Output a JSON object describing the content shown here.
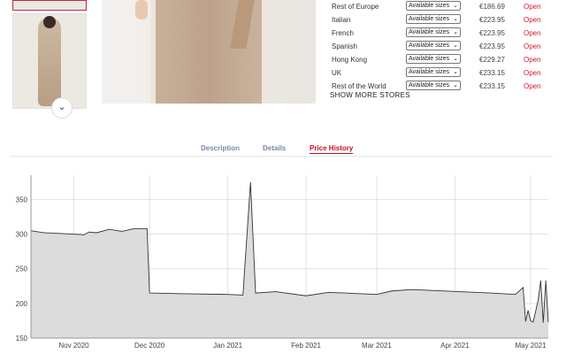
{
  "stores": [
    {
      "name": "Rest of Europe",
      "select": "Available sizes",
      "price": "€186.69",
      "status": "Open"
    },
    {
      "name": "Italian",
      "select": "Available sizes",
      "price": "€223.95",
      "status": "Open"
    },
    {
      "name": "French",
      "select": "Available sizes",
      "price": "€223.95",
      "status": "Open"
    },
    {
      "name": "Spanish",
      "select": "Available sizes",
      "price": "€223.95",
      "status": "Open"
    },
    {
      "name": "Hong Kong",
      "select": "Available sizes",
      "price": "€229.27",
      "status": "Open"
    },
    {
      "name": "UK",
      "select": "Available sizes",
      "price": "€233.15",
      "status": "Open"
    },
    {
      "name": "Rest of the World",
      "select": "Available sizes",
      "price": "€233.15",
      "status": "Open"
    }
  ],
  "show_more": "SHOW MORE STORES",
  "tabs": [
    "Description",
    "Details",
    "Price History"
  ],
  "active_tab": "Price History",
  "chart_data": {
    "type": "area",
    "yticks": [
      150,
      200,
      250,
      300,
      350
    ],
    "ylim": [
      150,
      385
    ],
    "xticks": [
      "Nov 2020",
      "Dec 2020",
      "Jan 2021",
      "Feb 2021",
      "Mar 2021",
      "Apr 2021",
      "May 2021"
    ],
    "color": "#dcdcdc",
    "line_color": "#333333",
    "points": [
      [
        "2020-10-15",
        305
      ],
      [
        "2020-10-20",
        302
      ],
      [
        "2020-11-01",
        300
      ],
      [
        "2020-11-05",
        299
      ],
      [
        "2020-11-07",
        303
      ],
      [
        "2020-11-10",
        302
      ],
      [
        "2020-11-15",
        307
      ],
      [
        "2020-11-20",
        304
      ],
      [
        "2020-11-25",
        308
      ],
      [
        "2020-11-30",
        308
      ],
      [
        "2020-12-01",
        215
      ],
      [
        "2020-12-15",
        214
      ],
      [
        "2021-01-01",
        213
      ],
      [
        "2021-01-07",
        212
      ],
      [
        "2021-01-10",
        375
      ],
      [
        "2021-01-12",
        215
      ],
      [
        "2021-01-20",
        217
      ],
      [
        "2021-02-01",
        211
      ],
      [
        "2021-02-10",
        216
      ],
      [
        "2021-03-01",
        213
      ],
      [
        "2021-03-07",
        218
      ],
      [
        "2021-03-15",
        220
      ],
      [
        "2021-04-15",
        215
      ],
      [
        "2021-04-25",
        213
      ],
      [
        "2021-04-28",
        223
      ],
      [
        "2021-04-29",
        174
      ],
      [
        "2021-04-30",
        190
      ],
      [
        "2021-05-01",
        175
      ],
      [
        "2021-05-02",
        173
      ],
      [
        "2021-05-04",
        205
      ],
      [
        "2021-05-05",
        233
      ],
      [
        "2021-05-06",
        172
      ],
      [
        "2021-05-07",
        233
      ],
      [
        "2021-05-08",
        173
      ]
    ]
  }
}
